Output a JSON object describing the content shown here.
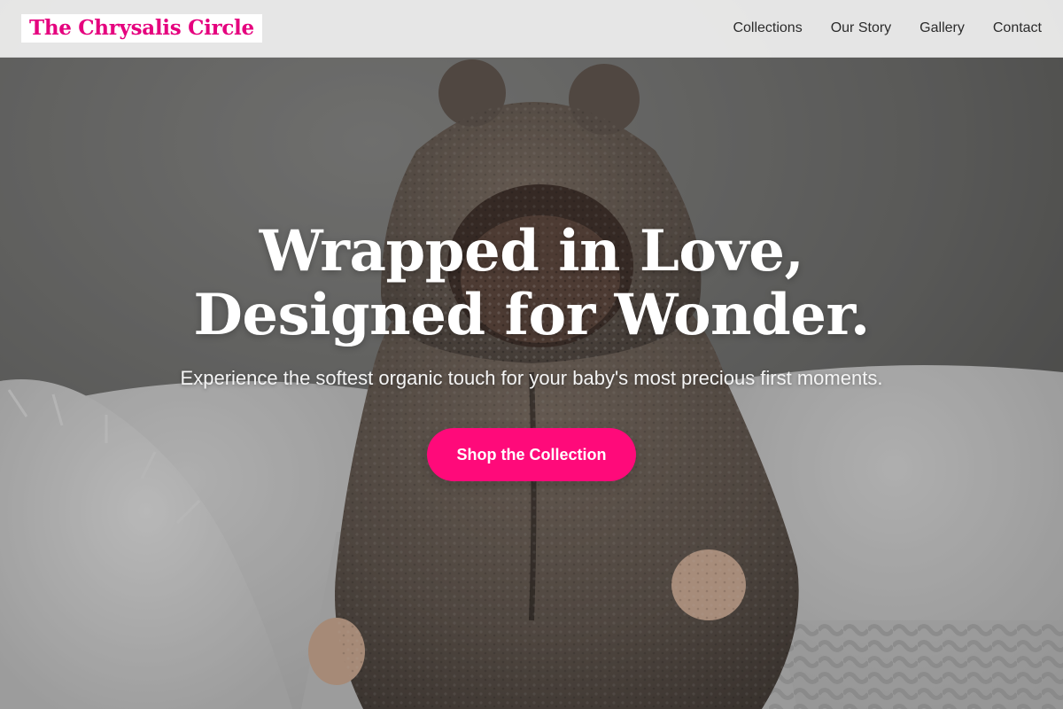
{
  "brand": {
    "name": "The Chrysalis Circle"
  },
  "nav": {
    "items": [
      {
        "label": "Collections"
      },
      {
        "label": "Our Story"
      },
      {
        "label": "Gallery"
      },
      {
        "label": "Contact"
      }
    ]
  },
  "hero": {
    "title_line1": "Wrapped in Love,",
    "title_line2": "Designed for Wonder.",
    "subtitle": "Experience the softest organic touch for your baby's most precious first moments.",
    "cta_label": "Shop the Collection",
    "image_subject": "baby-in-fleece-bear-suit"
  },
  "colors": {
    "brand": "#e5007e",
    "accent": "#ff0a7a",
    "header_bg": "#f0f0f0",
    "nav_text": "#2b2b2b"
  }
}
